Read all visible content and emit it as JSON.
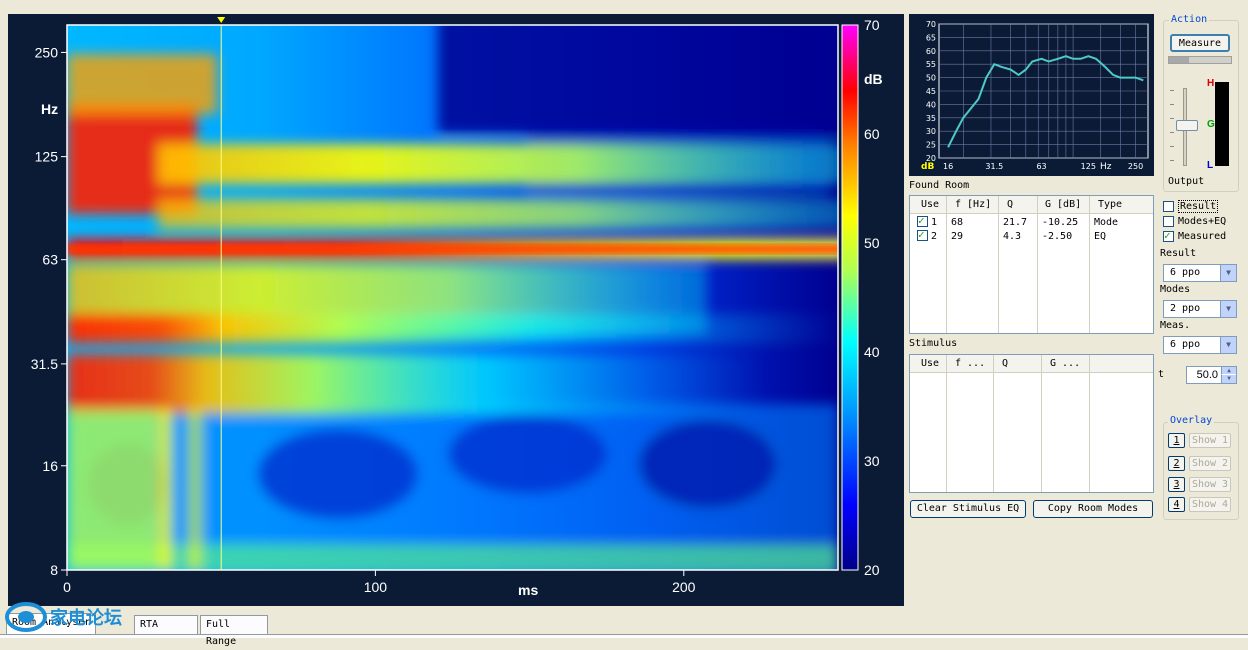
{
  "spectrogram": {
    "y_ticks": [
      "250",
      "125",
      "63",
      "31.5",
      "16",
      "8"
    ],
    "y_unit": "Hz",
    "x_ticks": [
      "0",
      "100",
      "200"
    ],
    "x_unit": "ms",
    "colorbar_ticks": [
      "70",
      "60",
      "50",
      "40",
      "30",
      "20"
    ],
    "colorbar_unit": "dB",
    "cursor_time_ms": 50
  },
  "mini_chart": {
    "y_ticks": [
      "70",
      "65",
      "60",
      "55",
      "50",
      "45",
      "40",
      "35",
      "30",
      "25",
      "20"
    ],
    "x_ticks": [
      "16",
      "31.5",
      "63",
      "125",
      "250"
    ],
    "x_unit": "Hz",
    "y_unit": "dB",
    "response_color": "#4ec9c9"
  },
  "found_room": {
    "title": "Found Room",
    "headers": [
      "Use",
      "f [Hz]",
      "Q",
      "G [dB]",
      "Type"
    ],
    "rows": [
      {
        "checked": true,
        "index": "1",
        "f": "68",
        "q": "21.7",
        "g": "-10.25",
        "type": "Mode"
      },
      {
        "checked": true,
        "index": "2",
        "f": "29",
        "q": "4.3",
        "g": "-2.50",
        "type": "EQ"
      }
    ]
  },
  "stimulus": {
    "title": "Stimulus",
    "headers": [
      "Use",
      "f ...",
      "Q",
      "G ..."
    ]
  },
  "buttons": {
    "clear_stimulus": "Clear Stimulus EQ",
    "copy_room_modes": "Copy Room Modes"
  },
  "action": {
    "title": "Action",
    "measure": "Measure",
    "output": "Output",
    "meter_high": "H",
    "meter_good": "G",
    "meter_low": "L"
  },
  "options": {
    "result_label": "Result",
    "modes_eq_label": "Modes+EQ",
    "measured_label": "Measured",
    "result_checked": false,
    "modes_eq_checked": false,
    "measured_checked": true,
    "result_select_label": "Result",
    "result_select_value": "6 ppo",
    "modes_select_label": "Modes",
    "modes_select_value": "2 ppo",
    "meas_select_label": "Meas.",
    "meas_select_value": "6 ppo",
    "t_label": "t",
    "t_value": "50.0"
  },
  "overlay": {
    "title": "Overlay",
    "items": [
      {
        "num": "1",
        "show": "Show 1"
      },
      {
        "num": "2",
        "show": "Show 2"
      },
      {
        "num": "3",
        "show": "Show 3"
      },
      {
        "num": "4",
        "show": "Show 4"
      }
    ]
  },
  "tabs": [
    "Room Analyser",
    "RTA",
    "Full Range"
  ],
  "watermark": "家电论坛"
}
